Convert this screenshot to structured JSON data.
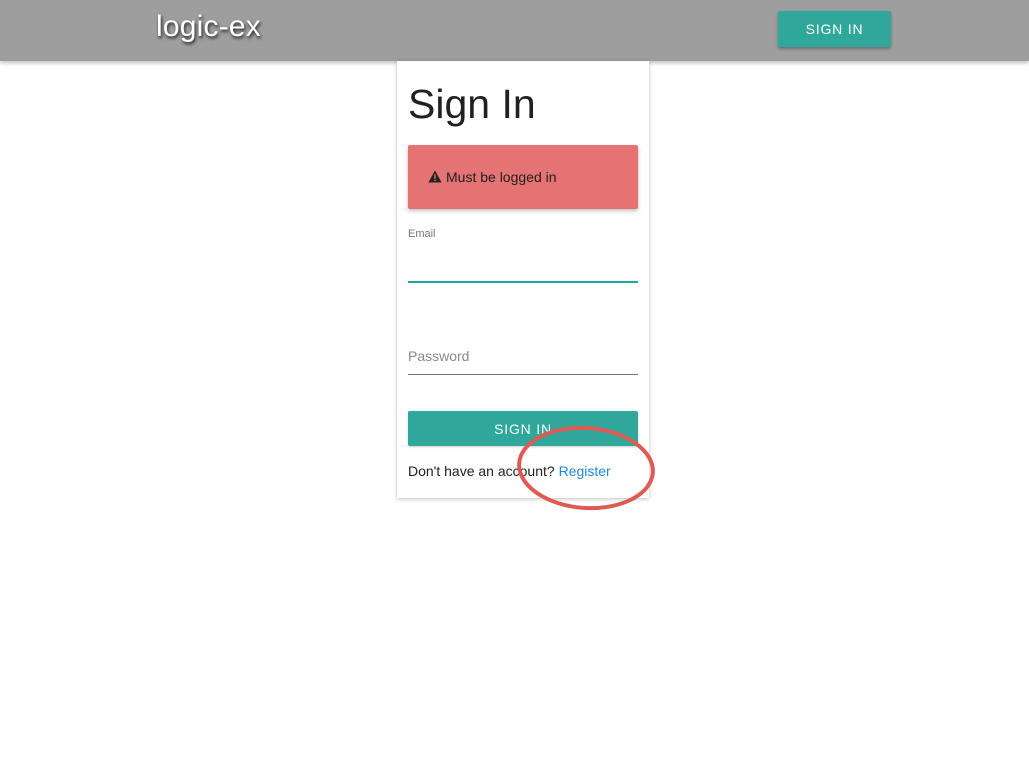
{
  "header": {
    "brand": "logic-ex",
    "signin_label": "SIGN IN"
  },
  "form": {
    "title": "Sign In",
    "alert": {
      "icon": "warning-icon",
      "message": "Must be logged in",
      "color": "#e57373"
    },
    "email": {
      "label": "Email",
      "value": ""
    },
    "password": {
      "placeholder": "Password",
      "value": ""
    },
    "submit_label": "SIGN IN",
    "register_prompt": "Don't have an account?",
    "register_link": "Register"
  },
  "colors": {
    "app_bar": "#9e9e9e",
    "accent": "#2fa89b",
    "link": "#1e88e5",
    "annotation": "#e05a55"
  },
  "annotation": {
    "shape": "ellipse",
    "target": "register-link"
  }
}
